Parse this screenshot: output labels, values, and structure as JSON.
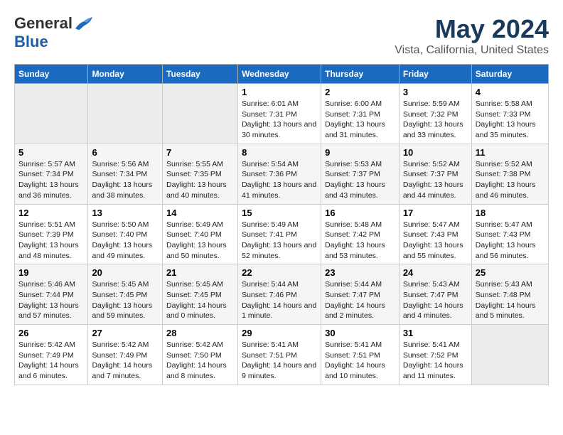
{
  "logo": {
    "general": "General",
    "blue": "Blue"
  },
  "title": "May 2024",
  "subtitle": "Vista, California, United States",
  "days_of_week": [
    "Sunday",
    "Monday",
    "Tuesday",
    "Wednesday",
    "Thursday",
    "Friday",
    "Saturday"
  ],
  "weeks": [
    [
      {
        "day": "",
        "info": ""
      },
      {
        "day": "",
        "info": ""
      },
      {
        "day": "",
        "info": ""
      },
      {
        "day": "1",
        "info": "Sunrise: 6:01 AM\nSunset: 7:31 PM\nDaylight: 13 hours and 30 minutes."
      },
      {
        "day": "2",
        "info": "Sunrise: 6:00 AM\nSunset: 7:31 PM\nDaylight: 13 hours and 31 minutes."
      },
      {
        "day": "3",
        "info": "Sunrise: 5:59 AM\nSunset: 7:32 PM\nDaylight: 13 hours and 33 minutes."
      },
      {
        "day": "4",
        "info": "Sunrise: 5:58 AM\nSunset: 7:33 PM\nDaylight: 13 hours and 35 minutes."
      }
    ],
    [
      {
        "day": "5",
        "info": "Sunrise: 5:57 AM\nSunset: 7:34 PM\nDaylight: 13 hours and 36 minutes."
      },
      {
        "day": "6",
        "info": "Sunrise: 5:56 AM\nSunset: 7:34 PM\nDaylight: 13 hours and 38 minutes."
      },
      {
        "day": "7",
        "info": "Sunrise: 5:55 AM\nSunset: 7:35 PM\nDaylight: 13 hours and 40 minutes."
      },
      {
        "day": "8",
        "info": "Sunrise: 5:54 AM\nSunset: 7:36 PM\nDaylight: 13 hours and 41 minutes."
      },
      {
        "day": "9",
        "info": "Sunrise: 5:53 AM\nSunset: 7:37 PM\nDaylight: 13 hours and 43 minutes."
      },
      {
        "day": "10",
        "info": "Sunrise: 5:52 AM\nSunset: 7:37 PM\nDaylight: 13 hours and 44 minutes."
      },
      {
        "day": "11",
        "info": "Sunrise: 5:52 AM\nSunset: 7:38 PM\nDaylight: 13 hours and 46 minutes."
      }
    ],
    [
      {
        "day": "12",
        "info": "Sunrise: 5:51 AM\nSunset: 7:39 PM\nDaylight: 13 hours and 48 minutes."
      },
      {
        "day": "13",
        "info": "Sunrise: 5:50 AM\nSunset: 7:40 PM\nDaylight: 13 hours and 49 minutes."
      },
      {
        "day": "14",
        "info": "Sunrise: 5:49 AM\nSunset: 7:40 PM\nDaylight: 13 hours and 50 minutes."
      },
      {
        "day": "15",
        "info": "Sunrise: 5:49 AM\nSunset: 7:41 PM\nDaylight: 13 hours and 52 minutes."
      },
      {
        "day": "16",
        "info": "Sunrise: 5:48 AM\nSunset: 7:42 PM\nDaylight: 13 hours and 53 minutes."
      },
      {
        "day": "17",
        "info": "Sunrise: 5:47 AM\nSunset: 7:43 PM\nDaylight: 13 hours and 55 minutes."
      },
      {
        "day": "18",
        "info": "Sunrise: 5:47 AM\nSunset: 7:43 PM\nDaylight: 13 hours and 56 minutes."
      }
    ],
    [
      {
        "day": "19",
        "info": "Sunrise: 5:46 AM\nSunset: 7:44 PM\nDaylight: 13 hours and 57 minutes."
      },
      {
        "day": "20",
        "info": "Sunrise: 5:45 AM\nSunset: 7:45 PM\nDaylight: 13 hours and 59 minutes."
      },
      {
        "day": "21",
        "info": "Sunrise: 5:45 AM\nSunset: 7:45 PM\nDaylight: 14 hours and 0 minutes."
      },
      {
        "day": "22",
        "info": "Sunrise: 5:44 AM\nSunset: 7:46 PM\nDaylight: 14 hours and 1 minute."
      },
      {
        "day": "23",
        "info": "Sunrise: 5:44 AM\nSunset: 7:47 PM\nDaylight: 14 hours and 2 minutes."
      },
      {
        "day": "24",
        "info": "Sunrise: 5:43 AM\nSunset: 7:47 PM\nDaylight: 14 hours and 4 minutes."
      },
      {
        "day": "25",
        "info": "Sunrise: 5:43 AM\nSunset: 7:48 PM\nDaylight: 14 hours and 5 minutes."
      }
    ],
    [
      {
        "day": "26",
        "info": "Sunrise: 5:42 AM\nSunset: 7:49 PM\nDaylight: 14 hours and 6 minutes."
      },
      {
        "day": "27",
        "info": "Sunrise: 5:42 AM\nSunset: 7:49 PM\nDaylight: 14 hours and 7 minutes."
      },
      {
        "day": "28",
        "info": "Sunrise: 5:42 AM\nSunset: 7:50 PM\nDaylight: 14 hours and 8 minutes."
      },
      {
        "day": "29",
        "info": "Sunrise: 5:41 AM\nSunset: 7:51 PM\nDaylight: 14 hours and 9 minutes."
      },
      {
        "day": "30",
        "info": "Sunrise: 5:41 AM\nSunset: 7:51 PM\nDaylight: 14 hours and 10 minutes."
      },
      {
        "day": "31",
        "info": "Sunrise: 5:41 AM\nSunset: 7:52 PM\nDaylight: 14 hours and 11 minutes."
      },
      {
        "day": "",
        "info": ""
      }
    ]
  ]
}
